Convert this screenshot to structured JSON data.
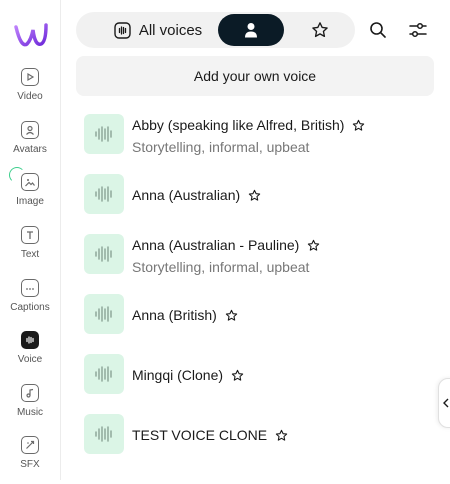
{
  "sidebar": {
    "items": [
      {
        "label": "Video",
        "icon": "video-icon"
      },
      {
        "label": "Avatars",
        "icon": "avatar-icon"
      },
      {
        "label": "Image",
        "icon": "image-icon"
      },
      {
        "label": "Text",
        "icon": "text-icon"
      },
      {
        "label": "Captions",
        "icon": "captions-icon"
      },
      {
        "label": "Voice",
        "icon": "voice-icon",
        "active": true
      },
      {
        "label": "Music",
        "icon": "music-icon"
      },
      {
        "label": "SFX",
        "icon": "sfx-icon"
      }
    ]
  },
  "tabs": {
    "all_voices_label": "All voices",
    "active": "my-voices"
  },
  "add_voice_label": "Add your own voice",
  "voices": [
    {
      "name": "Abby (speaking like Alfred, British)",
      "desc": "Storytelling, informal, upbeat"
    },
    {
      "name": "Anna (Australian)",
      "desc": ""
    },
    {
      "name": "Anna (Australian - Pauline)",
      "desc": "Storytelling, informal, upbeat"
    },
    {
      "name": "Anna (British)",
      "desc": ""
    },
    {
      "name": "Mingqi (Clone)",
      "desc": ""
    },
    {
      "name": "TEST VOICE CLONE",
      "desc": ""
    }
  ],
  "colors": {
    "accent": "#0b1b26",
    "wave_bg": "#dbf5e6",
    "logo": "#a855f7"
  }
}
